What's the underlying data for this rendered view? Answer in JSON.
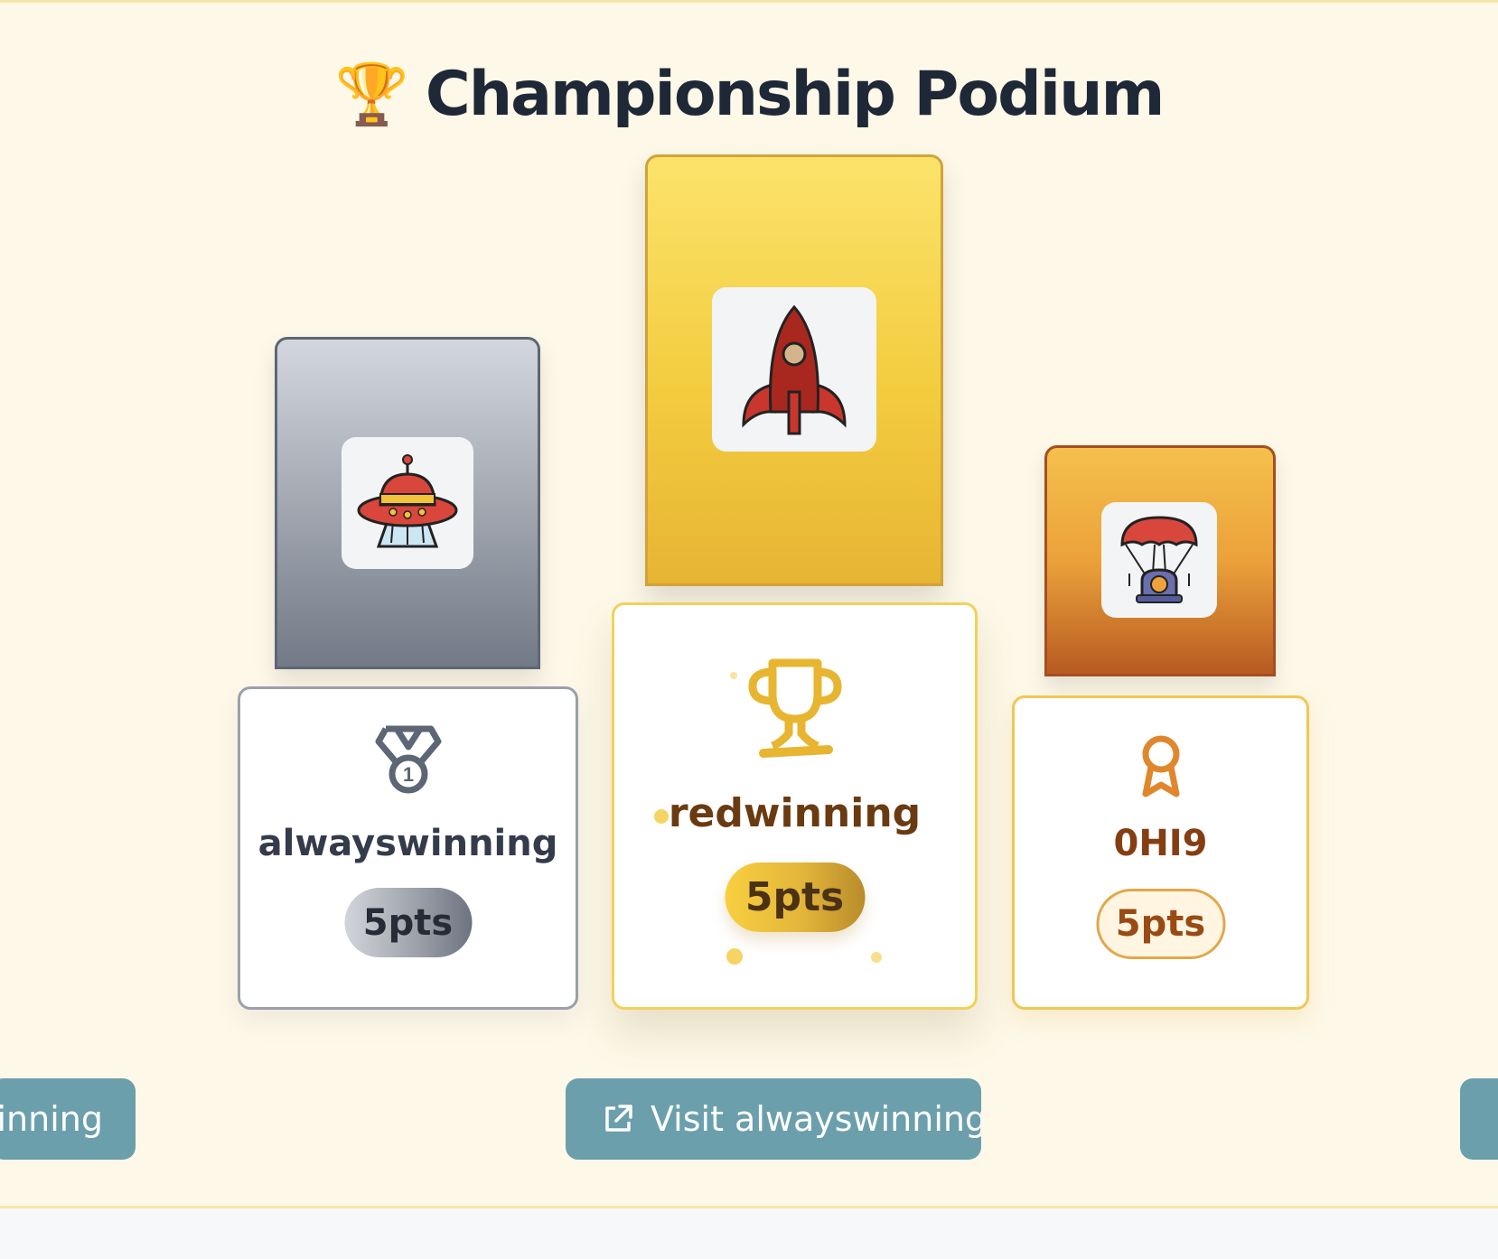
{
  "podium": {
    "title": "Championship Podium",
    "title_icon": "trophy-emoji",
    "title_icon_glyph": "🏆",
    "places": {
      "second": {
        "name": "alwayswinning",
        "points": "5pts",
        "avatar": "ufo-icon",
        "rank_icon": "medal-icon",
        "color": "#9aa0ab"
      },
      "first": {
        "name": "redwinning",
        "points": "5pts",
        "avatar": "rocket-icon",
        "rank_icon": "trophy-icon",
        "color": "#f2c53d"
      },
      "third": {
        "name": "0HI9",
        "points": "5pts",
        "avatar": "parachute-capsule-icon",
        "rank_icon": "award-ribbon-icon",
        "color": "#e0872e"
      }
    }
  },
  "visit_buttons": {
    "left_label": "winning",
    "center_label": "Visit alwayswinning",
    "center_icon": "external-link-icon",
    "color": "#6b9fac"
  }
}
